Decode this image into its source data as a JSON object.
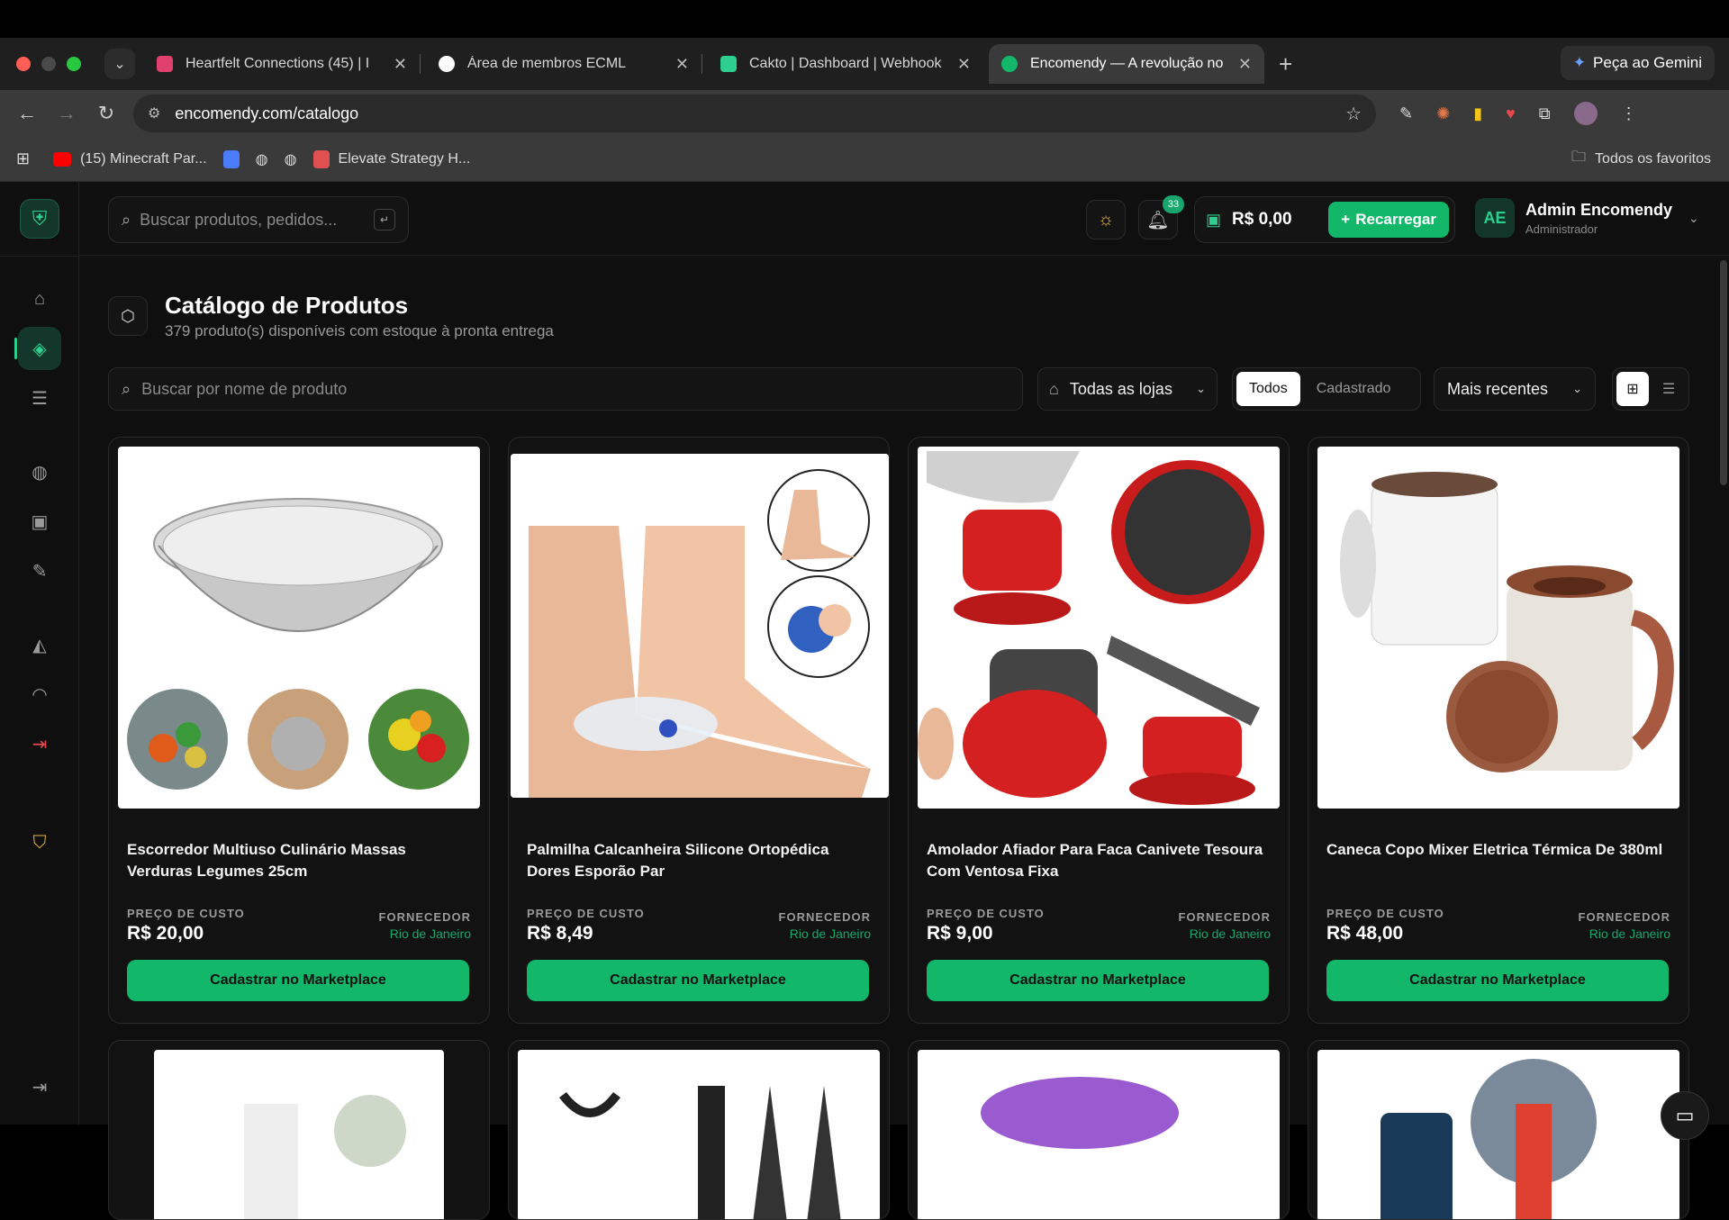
{
  "browser": {
    "tabs": [
      {
        "title": "Heartfelt Connections (45) | I",
        "fav_color": "#e0406e"
      },
      {
        "title": "Área de membros ECML",
        "fav_color": "#ffffff"
      },
      {
        "title": "Cakto | Dashboard | Webhook",
        "fav_color": "#2ecf8e"
      },
      {
        "title": "Encomendy — A revolução no",
        "fav_color": "#12b76a"
      }
    ],
    "gemini": "Peça ao Gemini",
    "url": "encomendy.com/catalogo",
    "bookmarks": [
      {
        "label": "(15) Minecraft Par...",
        "color": "#ff0000"
      },
      {
        "label": "",
        "color": "#4a7cf7"
      },
      {
        "label": "",
        "color": "#bbbbbb"
      },
      {
        "label": "",
        "color": "#bbbbbb"
      },
      {
        "label": "Elevate Strategy H...",
        "color": "#e05050"
      }
    ],
    "all_bookmarks": "Todos os favoritos"
  },
  "header": {
    "search_placeholder": "Buscar produtos, pedidos...",
    "notifications": "33",
    "balance": "R$ 0,00",
    "recharge": "Recarregar",
    "avatar": "AE",
    "user_name": "Admin Encomendy",
    "user_role": "Administrador"
  },
  "page": {
    "title": "Catálogo de Produtos",
    "subtitle": "379 produto(s) disponíveis com estoque à pronta entrega",
    "search_placeholder": "Buscar por nome de produto",
    "stores": "Todas as lojas",
    "filter_all": "Todos",
    "filter_registered": "Cadastrado",
    "sort": "Mais recentes"
  },
  "products": [
    {
      "name": "Escorredor Multiuso Culinário Massas Verduras Legumes 25cm",
      "cost_label": "PREÇO DE CUSTO",
      "cost": "R$ 20,00",
      "supplier_label": "FORNECEDOR",
      "supplier": "Rio de Janeiro",
      "cta": "Cadastrar no Marketplace"
    },
    {
      "name": "Palmilha Calcanheira Silicone Ortopédica Dores Esporão Par",
      "cost_label": "PREÇO DE CUSTO",
      "cost": "R$ 8,49",
      "supplier_label": "FORNECEDOR",
      "supplier": "Rio de Janeiro",
      "cta": "Cadastrar no Marketplace"
    },
    {
      "name": "Amolador Afiador Para Faca Canivete Tesoura Com Ventosa Fixa",
      "cost_label": "PREÇO DE CUSTO",
      "cost": "R$ 9,00",
      "supplier_label": "FORNECEDOR",
      "supplier": "Rio de Janeiro",
      "cta": "Cadastrar no Marketplace"
    },
    {
      "name": "Caneca Copo Mixer Eletrica Térmica De 380ml",
      "cost_label": "PREÇO DE CUSTO",
      "cost": "R$ 48,00",
      "supplier_label": "FORNECEDOR",
      "supplier": "Rio de Janeiro",
      "cta": "Cadastrar no Marketplace"
    }
  ],
  "colors": {
    "accent": "#12b76a",
    "background": "#0f0f10",
    "danger": "#e5484d",
    "warning": "#e3b341"
  }
}
